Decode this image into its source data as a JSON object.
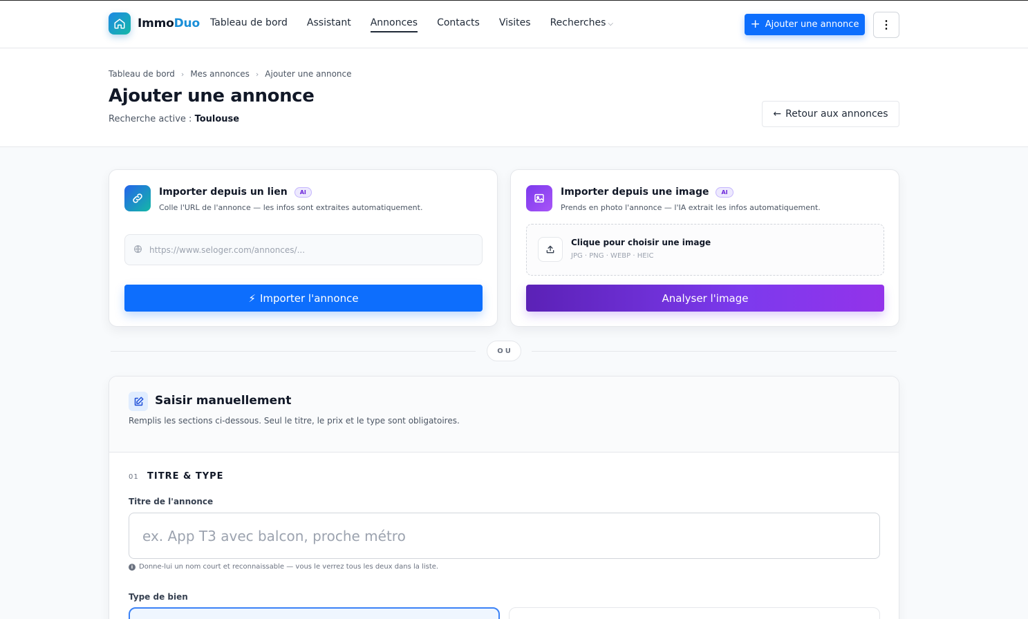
{
  "brand": {
    "name_part1": "Immo",
    "name_part2": "Duo",
    "accent": "#1a8fd8"
  },
  "nav": {
    "items": [
      {
        "label": "Tableau de bord"
      },
      {
        "label": "Assistant"
      },
      {
        "label": "Annonces",
        "active": true
      },
      {
        "label": "Contacts"
      },
      {
        "label": "Visites"
      },
      {
        "label": "Recherches",
        "dropdown": true
      }
    ],
    "add_button": "Ajouter une annonce",
    "more_icon": "kebab-menu-icon"
  },
  "breadcrumb": [
    "Tableau de bord",
    "Mes annonces",
    "Ajouter une annonce"
  ],
  "page": {
    "title": "Ajouter une annonce",
    "subtitle_prefix": "Recherche active : ",
    "subtitle_value": "Toulouse",
    "back_button": "Retour aux annonces"
  },
  "import_link": {
    "title": "Importer depuis un lien",
    "badge": "AI",
    "description": "Colle l'URL de l'annonce — les infos sont extraites automatiquement.",
    "placeholder": "https://www.seloger.com/annonces/...",
    "button": "Importer l'annonce"
  },
  "import_image": {
    "title": "Importer depuis une image",
    "badge": "AI",
    "description": "Prends en photo l'annonce — l'IA extrait les infos automatiquement.",
    "dropzone_title": "Clique pour choisir une image",
    "dropzone_formats": "JPG · PNG · WEBP · HEIC",
    "button": "Analyser l'image"
  },
  "divider": "OU",
  "manual": {
    "title": "Saisir manuellement",
    "description": "Remplis les sections ci-dessous. Seul le titre, le prix et le type sont obligatoires.",
    "section_number": "01",
    "section_title": "TITRE & TYPE",
    "title_label": "Titre de l'annonce",
    "title_placeholder": "ex. App T3 avec balcon, proche métro",
    "title_hint": "Donne-lui un nom court et reconnaissable — vous le verrez tous les deux dans la liste.",
    "type_label": "Type de bien"
  },
  "colors": {
    "primary": "#0d6efd",
    "purple": "#7c3aed"
  }
}
